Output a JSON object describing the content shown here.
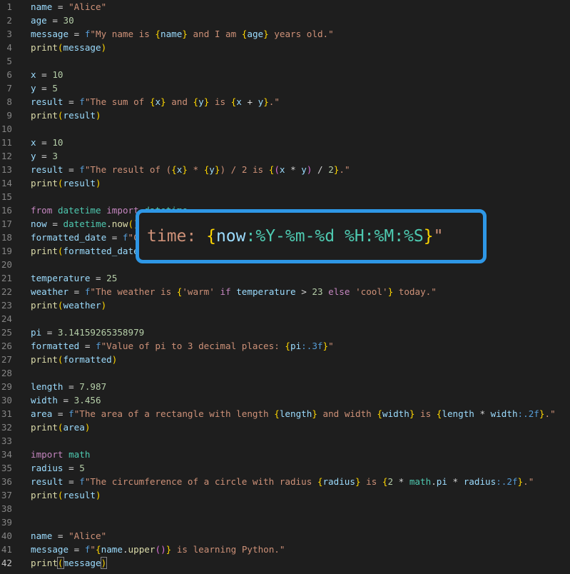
{
  "editor": {
    "active_line": 42,
    "lines": [
      [
        [
          "t-var",
          "name"
        ],
        [
          "t-def",
          " = "
        ],
        [
          "t-str",
          "\"Alice\""
        ]
      ],
      [
        [
          "t-var",
          "age"
        ],
        [
          "t-def",
          " = "
        ],
        [
          "t-num",
          "30"
        ]
      ],
      [
        [
          "t-var",
          "message"
        ],
        [
          "t-def",
          " = "
        ],
        [
          "t-fp",
          "f"
        ],
        [
          "t-str",
          "\"My name is "
        ],
        [
          "t-br",
          "{"
        ],
        [
          "t-var",
          "name"
        ],
        [
          "t-br",
          "}"
        ],
        [
          "t-str",
          " and I am "
        ],
        [
          "t-br",
          "{"
        ],
        [
          "t-var",
          "age"
        ],
        [
          "t-br",
          "}"
        ],
        [
          "t-str",
          " years old.\""
        ]
      ],
      [
        [
          "t-fn",
          "print"
        ],
        [
          "t-br",
          "("
        ],
        [
          "t-var",
          "message"
        ],
        [
          "t-br",
          ")"
        ]
      ],
      [],
      [
        [
          "t-var",
          "x"
        ],
        [
          "t-def",
          " = "
        ],
        [
          "t-num",
          "10"
        ]
      ],
      [
        [
          "t-var",
          "y"
        ],
        [
          "t-def",
          " = "
        ],
        [
          "t-num",
          "5"
        ]
      ],
      [
        [
          "t-var",
          "result"
        ],
        [
          "t-def",
          " = "
        ],
        [
          "t-fp",
          "f"
        ],
        [
          "t-str",
          "\"The sum of "
        ],
        [
          "t-br",
          "{"
        ],
        [
          "t-var",
          "x"
        ],
        [
          "t-br",
          "}"
        ],
        [
          "t-str",
          " and "
        ],
        [
          "t-br",
          "{"
        ],
        [
          "t-var",
          "y"
        ],
        [
          "t-br",
          "}"
        ],
        [
          "t-str",
          " is "
        ],
        [
          "t-br",
          "{"
        ],
        [
          "t-var",
          "x"
        ],
        [
          "t-def",
          " + "
        ],
        [
          "t-var",
          "y"
        ],
        [
          "t-br",
          "}"
        ],
        [
          "t-str",
          ".\""
        ]
      ],
      [
        [
          "t-fn",
          "print"
        ],
        [
          "t-br",
          "("
        ],
        [
          "t-var",
          "result"
        ],
        [
          "t-br",
          ")"
        ]
      ],
      [],
      [
        [
          "t-var",
          "x"
        ],
        [
          "t-def",
          " = "
        ],
        [
          "t-num",
          "10"
        ]
      ],
      [
        [
          "t-var",
          "y"
        ],
        [
          "t-def",
          " = "
        ],
        [
          "t-num",
          "3"
        ]
      ],
      [
        [
          "t-var",
          "result"
        ],
        [
          "t-def",
          " = "
        ],
        [
          "t-fp",
          "f"
        ],
        [
          "t-str",
          "\"The result of ("
        ],
        [
          "t-br",
          "{"
        ],
        [
          "t-var",
          "x"
        ],
        [
          "t-br",
          "}"
        ],
        [
          "t-str",
          " * "
        ],
        [
          "t-br",
          "{"
        ],
        [
          "t-var",
          "y"
        ],
        [
          "t-br",
          "}"
        ],
        [
          "t-str",
          ") / 2 is "
        ],
        [
          "t-br",
          "{"
        ],
        [
          "t-br2",
          "("
        ],
        [
          "t-var",
          "x"
        ],
        [
          "t-def",
          " * "
        ],
        [
          "t-var",
          "y"
        ],
        [
          "t-br2",
          ")"
        ],
        [
          "t-def",
          " / "
        ],
        [
          "t-num",
          "2"
        ],
        [
          "t-br",
          "}"
        ],
        [
          "t-str",
          ".\""
        ]
      ],
      [
        [
          "t-fn",
          "print"
        ],
        [
          "t-br",
          "("
        ],
        [
          "t-var",
          "result"
        ],
        [
          "t-br",
          ")"
        ]
      ],
      [],
      [
        [
          "t-kw",
          "from"
        ],
        [
          "t-def",
          " "
        ],
        [
          "t-fmt",
          "datetime"
        ],
        [
          "t-def",
          " "
        ],
        [
          "t-kw",
          "import"
        ],
        [
          "t-def",
          " "
        ],
        [
          "t-fmt",
          "datetime"
        ]
      ],
      [
        [
          "t-var",
          "now"
        ],
        [
          "t-def",
          " = "
        ],
        [
          "t-fmt",
          "datetime"
        ],
        [
          "t-def",
          "."
        ],
        [
          "t-fn",
          "now"
        ],
        [
          "t-br",
          "("
        ],
        [
          "t-br",
          ")"
        ]
      ],
      [
        [
          "t-var",
          "formatted_date"
        ],
        [
          "t-def",
          " = "
        ],
        [
          "t-fp",
          "f"
        ],
        [
          "t-str",
          "\"Current date and time: "
        ],
        [
          "t-br",
          "{"
        ],
        [
          "t-var",
          "now"
        ],
        [
          "t-fmt",
          ":%Y-%m-%d %H:%M:%S"
        ],
        [
          "t-br",
          "}"
        ],
        [
          "t-str",
          "\""
        ]
      ],
      [
        [
          "t-fn",
          "print"
        ],
        [
          "t-br",
          "("
        ],
        [
          "t-var",
          "formatted_date"
        ],
        [
          "t-br",
          ")"
        ]
      ],
      [],
      [
        [
          "t-var",
          "temperature"
        ],
        [
          "t-def",
          " = "
        ],
        [
          "t-num",
          "25"
        ]
      ],
      [
        [
          "t-var",
          "weather"
        ],
        [
          "t-def",
          " = "
        ],
        [
          "t-fp",
          "f"
        ],
        [
          "t-str",
          "\"The weather is "
        ],
        [
          "t-br",
          "{"
        ],
        [
          "t-str",
          "'warm'"
        ],
        [
          "t-def",
          " "
        ],
        [
          "t-kw",
          "if"
        ],
        [
          "t-def",
          " "
        ],
        [
          "t-var",
          "temperature"
        ],
        [
          "t-def",
          " > "
        ],
        [
          "t-num",
          "23"
        ],
        [
          "t-def",
          " "
        ],
        [
          "t-kw",
          "else"
        ],
        [
          "t-def",
          " "
        ],
        [
          "t-str",
          "'cool'"
        ],
        [
          "t-br",
          "}"
        ],
        [
          "t-str",
          " today.\""
        ]
      ],
      [
        [
          "t-fn",
          "print"
        ],
        [
          "t-br",
          "("
        ],
        [
          "t-var",
          "weather"
        ],
        [
          "t-br",
          ")"
        ]
      ],
      [],
      [
        [
          "t-var",
          "pi"
        ],
        [
          "t-def",
          " = "
        ],
        [
          "t-num",
          "3.14159265358979"
        ]
      ],
      [
        [
          "t-var",
          "formatted"
        ],
        [
          "t-def",
          " = "
        ],
        [
          "t-fp",
          "f"
        ],
        [
          "t-str",
          "\"Value of pi to 3 decimal places: "
        ],
        [
          "t-br",
          "{"
        ],
        [
          "t-var",
          "pi"
        ],
        [
          "t-fp",
          ":.3f"
        ],
        [
          "t-br",
          "}"
        ],
        [
          "t-str",
          "\""
        ]
      ],
      [
        [
          "t-fn",
          "print"
        ],
        [
          "t-br",
          "("
        ],
        [
          "t-var",
          "formatted"
        ],
        [
          "t-br",
          ")"
        ]
      ],
      [],
      [
        [
          "t-var",
          "length"
        ],
        [
          "t-def",
          " = "
        ],
        [
          "t-num",
          "7.987"
        ]
      ],
      [
        [
          "t-var",
          "width"
        ],
        [
          "t-def",
          " = "
        ],
        [
          "t-num",
          "3.456"
        ]
      ],
      [
        [
          "t-var",
          "area"
        ],
        [
          "t-def",
          " = "
        ],
        [
          "t-fp",
          "f"
        ],
        [
          "t-str",
          "\"The area of a rectangle with length "
        ],
        [
          "t-br",
          "{"
        ],
        [
          "t-var",
          "length"
        ],
        [
          "t-br",
          "}"
        ],
        [
          "t-str",
          " and width "
        ],
        [
          "t-br",
          "{"
        ],
        [
          "t-var",
          "width"
        ],
        [
          "t-br",
          "}"
        ],
        [
          "t-str",
          " is "
        ],
        [
          "t-br",
          "{"
        ],
        [
          "t-var",
          "length"
        ],
        [
          "t-def",
          " * "
        ],
        [
          "t-var",
          "width"
        ],
        [
          "t-fp",
          ":.2f"
        ],
        [
          "t-br",
          "}"
        ],
        [
          "t-str",
          ".\""
        ]
      ],
      [
        [
          "t-fn",
          "print"
        ],
        [
          "t-br",
          "("
        ],
        [
          "t-var",
          "area"
        ],
        [
          "t-br",
          ")"
        ]
      ],
      [],
      [
        [
          "t-kw",
          "import"
        ],
        [
          "t-def",
          " "
        ],
        [
          "t-fmt",
          "math"
        ]
      ],
      [
        [
          "t-var",
          "radius"
        ],
        [
          "t-def",
          " = "
        ],
        [
          "t-num",
          "5"
        ]
      ],
      [
        [
          "t-var",
          "result"
        ],
        [
          "t-def",
          " = "
        ],
        [
          "t-fp",
          "f"
        ],
        [
          "t-str",
          "\"The circumference of a circle with radius "
        ],
        [
          "t-br",
          "{"
        ],
        [
          "t-var",
          "radius"
        ],
        [
          "t-br",
          "}"
        ],
        [
          "t-str",
          " is "
        ],
        [
          "t-br",
          "{"
        ],
        [
          "t-num",
          "2"
        ],
        [
          "t-def",
          " * "
        ],
        [
          "t-fmt",
          "math"
        ],
        [
          "t-def",
          "."
        ],
        [
          "t-var",
          "pi"
        ],
        [
          "t-def",
          " * "
        ],
        [
          "t-var",
          "radius"
        ],
        [
          "t-fp",
          ":.2f"
        ],
        [
          "t-br",
          "}"
        ],
        [
          "t-str",
          ".\""
        ]
      ],
      [
        [
          "t-fn",
          "print"
        ],
        [
          "t-br",
          "("
        ],
        [
          "t-var",
          "result"
        ],
        [
          "t-br",
          ")"
        ]
      ],
      [],
      [],
      [
        [
          "t-var",
          "name"
        ],
        [
          "t-def",
          " = "
        ],
        [
          "t-str",
          "\"Alice\""
        ]
      ],
      [
        [
          "t-var",
          "message"
        ],
        [
          "t-def",
          " = "
        ],
        [
          "t-fp",
          "f"
        ],
        [
          "t-str",
          "\""
        ],
        [
          "t-br",
          "{"
        ],
        [
          "t-var",
          "name"
        ],
        [
          "t-def",
          "."
        ],
        [
          "t-fn",
          "upper"
        ],
        [
          "t-br2",
          "("
        ],
        [
          "t-br2",
          ")"
        ],
        [
          "t-br",
          "}"
        ],
        [
          "t-str",
          " is learning Python.\""
        ]
      ],
      [
        [
          "t-fn",
          "print"
        ],
        [
          "t-br",
          "(",
          "cursor"
        ],
        [
          "t-var",
          "message"
        ],
        [
          "t-br",
          ")",
          "cursor"
        ]
      ]
    ]
  },
  "zoom_popup": {
    "segments": [
      [
        "t-str",
        "time: "
      ],
      [
        "t-br",
        "{"
      ],
      [
        "t-var",
        "now"
      ],
      [
        "t-fmt",
        ":%Y-%m-%d %H:%M:%S"
      ],
      [
        "t-br",
        "}"
      ],
      [
        "t-str",
        "\""
      ]
    ]
  }
}
